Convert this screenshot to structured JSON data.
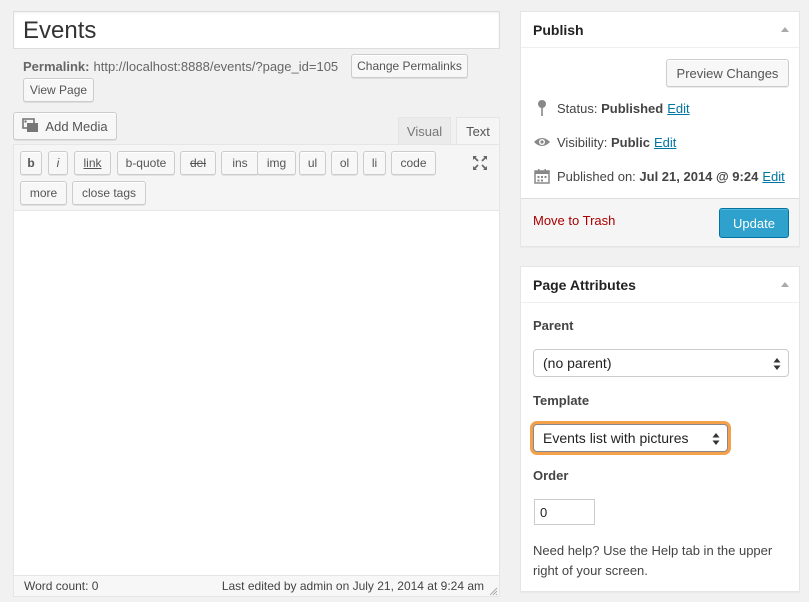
{
  "title": {
    "value": "Events"
  },
  "permalink": {
    "label": "Permalink:",
    "url": "http://localhost:8888/events/?page_id=105",
    "change_button": "Change Permalinks",
    "view_button": "View Page"
  },
  "editor": {
    "add_media": "Add Media",
    "tabs": {
      "visual": "Visual",
      "text": "Text"
    },
    "quicktags": [
      "b",
      "i",
      "link",
      "b-quote",
      "del",
      "ins",
      "img",
      "ul",
      "ol",
      "li",
      "code",
      "more",
      "close tags"
    ],
    "word_count": "Word count: 0",
    "last_edited": "Last edited by admin on July 21, 2014 at 9:24 am"
  },
  "publish": {
    "title": "Publish",
    "preview_button": "Preview Changes",
    "status_label": "Status:",
    "status_value": "Published",
    "visibility_label": "Visibility:",
    "visibility_value": "Public",
    "published_label": "Published on:",
    "published_value": "Jul 21, 2014 @ 9:24",
    "edit_label": "Edit",
    "trash_link": "Move to Trash",
    "update_button": "Update"
  },
  "page_attributes": {
    "title": "Page Attributes",
    "parent_label": "Parent",
    "parent_value": "(no parent)",
    "template_label": "Template",
    "template_value": "Events list with pictures",
    "order_label": "Order",
    "order_value": "0",
    "help_text": "Need help? Use the Help tab in the upper right of your screen."
  },
  "colors": {
    "accent": "#2ea2cc",
    "link": "#0074a2",
    "trash": "#aa0000",
    "focus_ring": "#f5a04b"
  },
  "icons": [
    "media-icon",
    "fullscreen-icon",
    "pin-icon",
    "eye-icon",
    "calendar-icon",
    "collapse-arrow-icon",
    "select-arrows-icon"
  ]
}
